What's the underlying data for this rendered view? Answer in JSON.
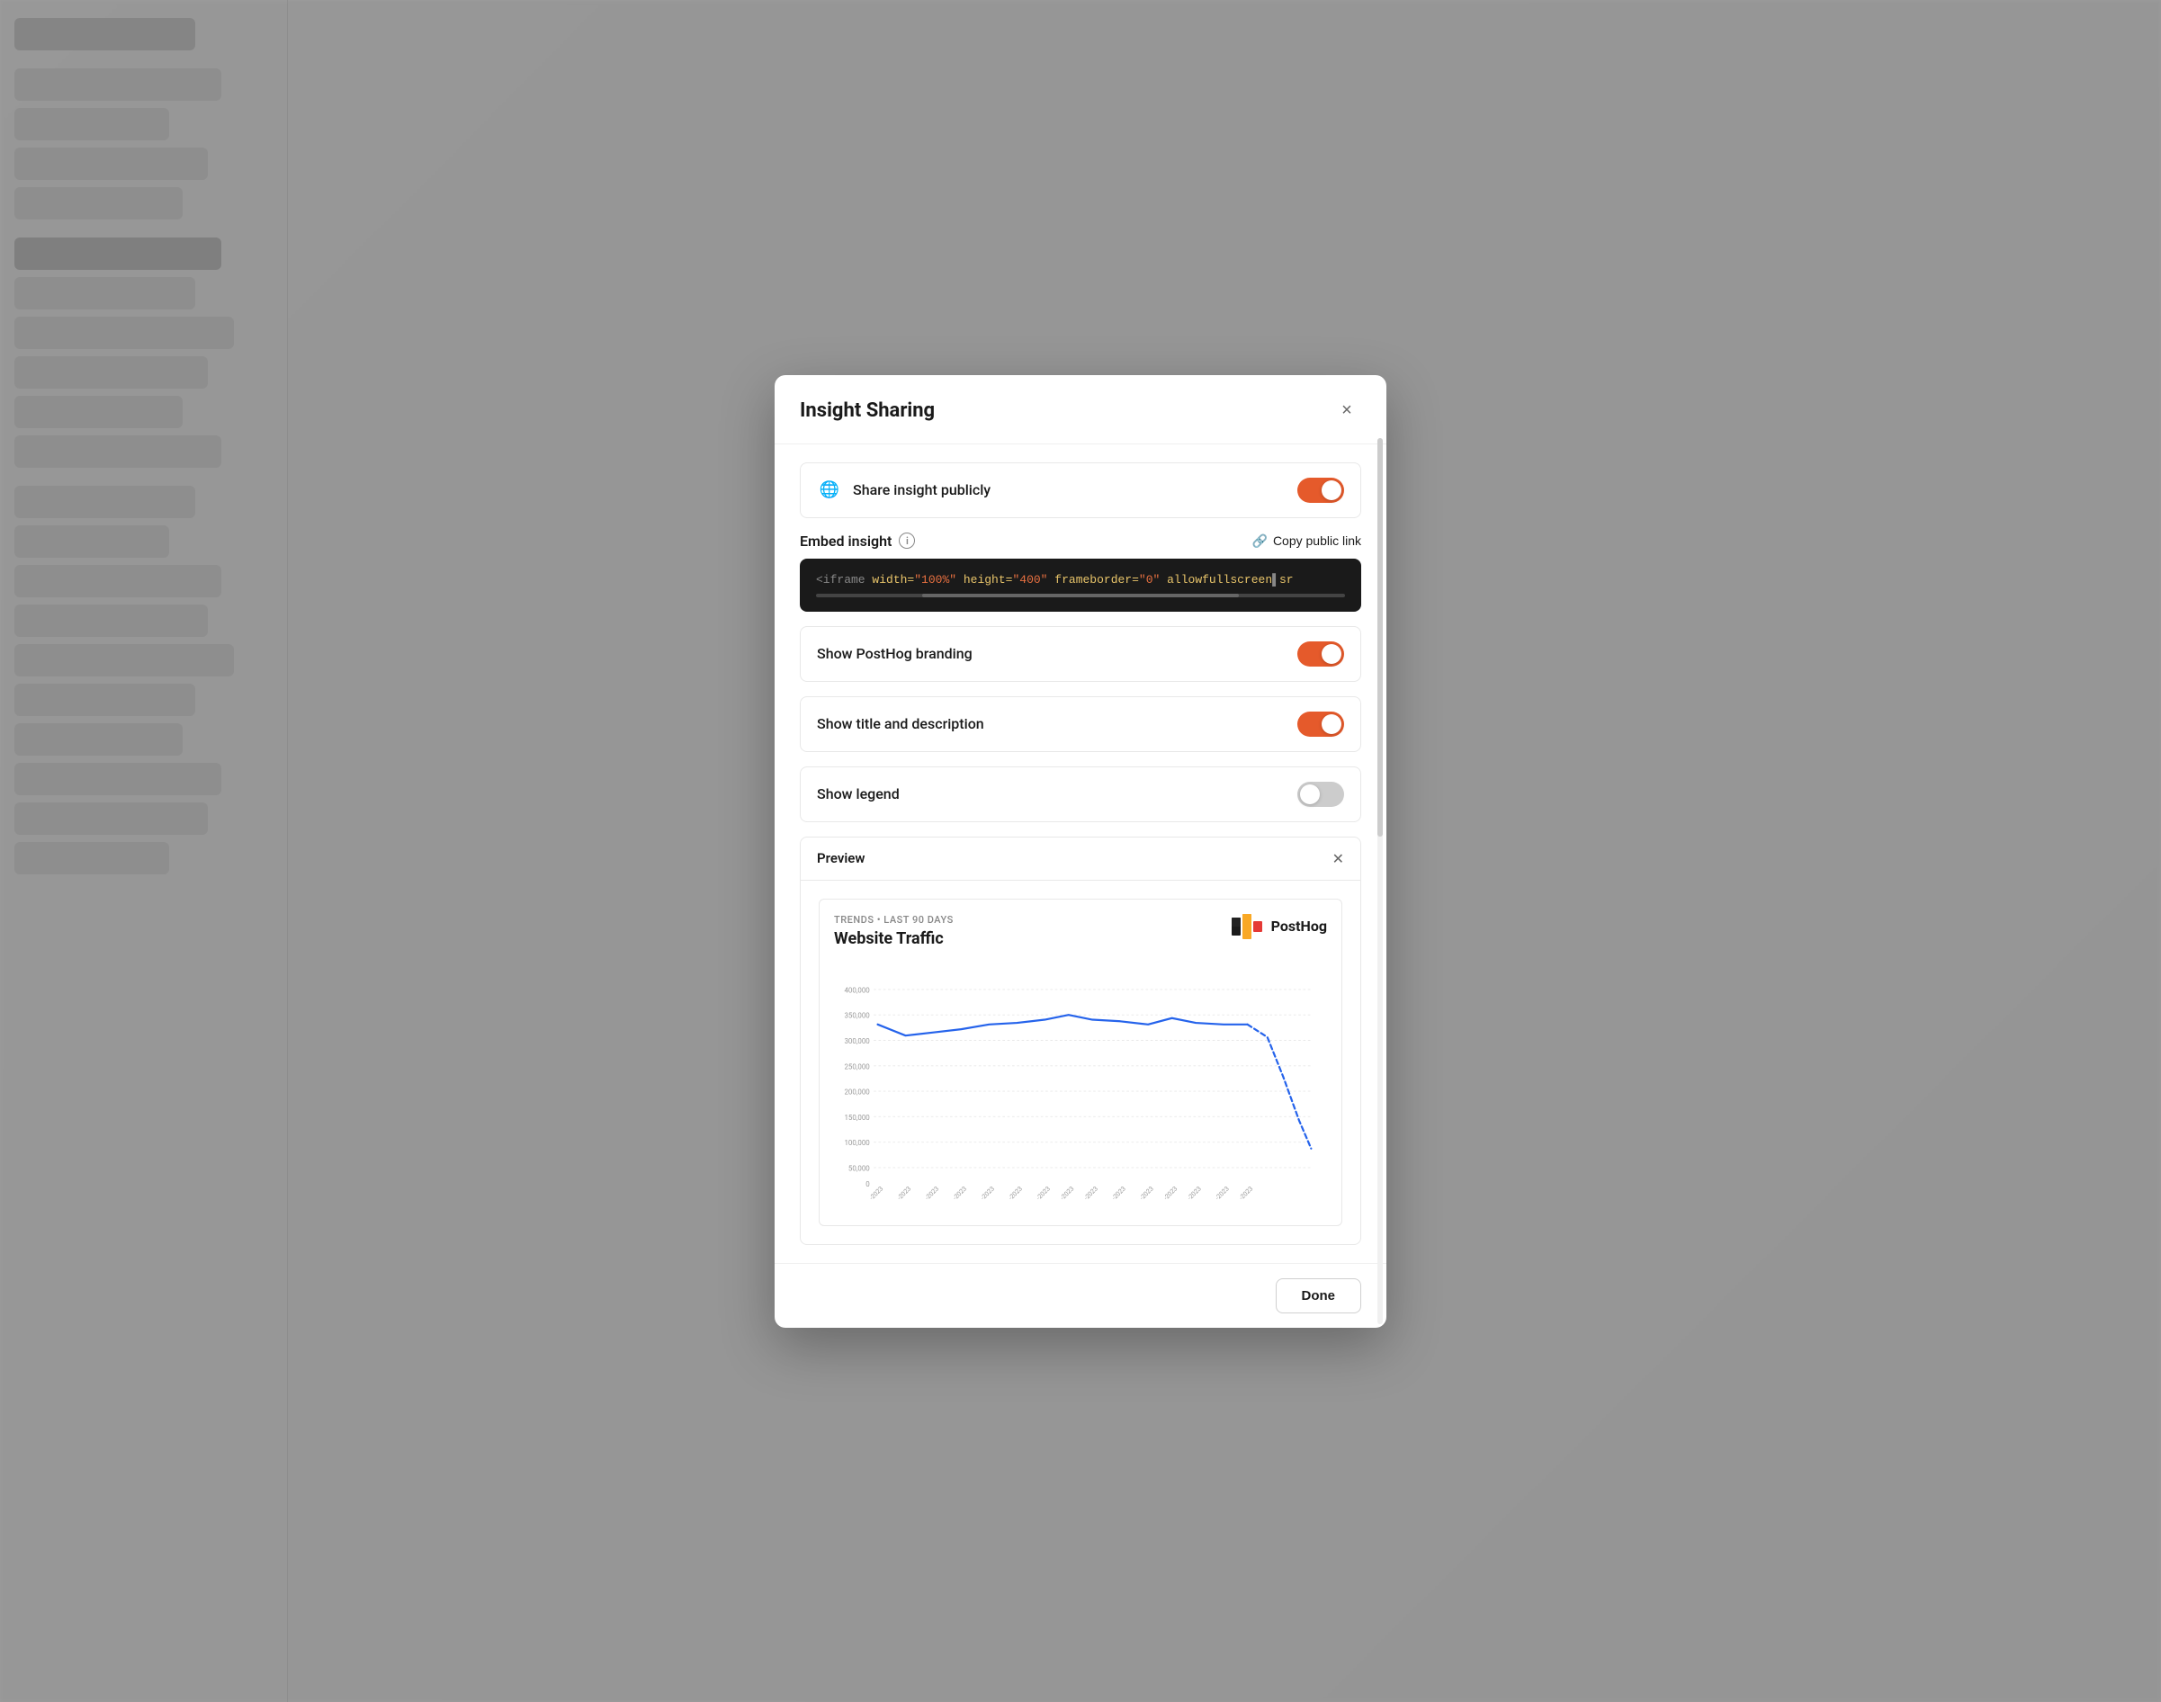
{
  "modal": {
    "title": "Insight Sharing",
    "close_label": "×",
    "share_insight": {
      "label": "Share insight publicly",
      "toggle_state": "on"
    },
    "embed_insight": {
      "label": "Embed insight",
      "copy_link_label": "Copy public link",
      "code_snippet": "<iframe width=\"100%\" height=\"400\" frameborder=\"0\" allowfullscreen src"
    },
    "show_posthog_branding": {
      "label": "Show PostHog branding",
      "toggle_state": "on"
    },
    "show_title_description": {
      "label": "Show title and description",
      "toggle_state": "on"
    },
    "show_legend": {
      "label": "Show legend",
      "toggle_state": "off"
    },
    "preview": {
      "label": "Preview",
      "chart_meta": "TRENDS • LAST 90 DAYS",
      "chart_title": "Website Traffic",
      "posthog_text": "PostHog",
      "y_axis_labels": [
        "400,000",
        "350,000",
        "300,000",
        "250,000",
        "200,000",
        "150,000",
        "100,000",
        "50,000",
        "0"
      ],
      "x_axis_labels": [
        "-2023",
        "-2023",
        "-2023",
        "-2023",
        "-2023",
        "-2023",
        "-2023",
        "-2023",
        "-2023",
        "-2023",
        "-2023",
        "-2023",
        "-2023",
        "-2023",
        "-2023"
      ]
    },
    "done_button_label": "Done"
  },
  "icons": {
    "globe": "🌐",
    "info": "i",
    "link": "🔗",
    "chevron_up": "×",
    "close": "×"
  }
}
